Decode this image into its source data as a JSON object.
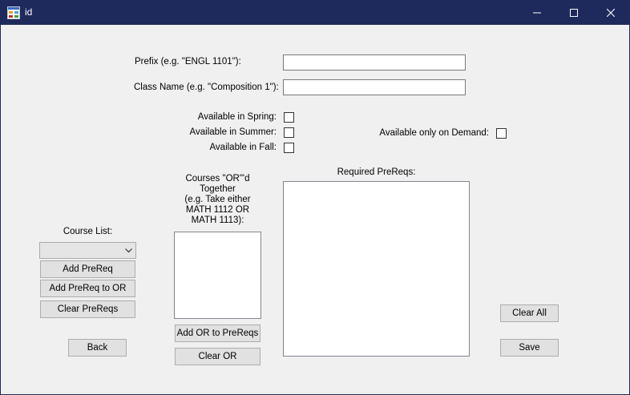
{
  "window": {
    "title": "id",
    "controls": {
      "minimize": "minimize-icon",
      "maximize": "maximize-icon",
      "close": "close-icon"
    }
  },
  "form": {
    "prefix_label": "Prefix (e.g. \"ENGL 1101\"):",
    "prefix_value": "",
    "class_name_label": "Class Name (e.g. \"Composition 1\"):",
    "class_name_value": "",
    "spring_label": "Available in Spring:",
    "summer_label": "Available in Summer:",
    "fall_label": "Available in Fall:",
    "on_demand_label": "Available only on Demand:",
    "spring_checked": false,
    "summer_checked": false,
    "fall_checked": false,
    "on_demand_checked": false
  },
  "course_list": {
    "label": "Course List:",
    "selected": "",
    "add_prereq": "Add PreReq",
    "add_prereq_to_or": "Add PreReq to OR",
    "clear_prereqs": "Clear PreReqs"
  },
  "or_group": {
    "label_line1": "Courses \"OR\"'d",
    "label_line2": "Together",
    "label_line3": "(e.g. Take either",
    "label_line4": "MATH 1112 OR",
    "label_line5": "MATH 1113):",
    "items": [],
    "add_or_to_prereqs": "Add OR to PreReqs",
    "clear_or": "Clear OR"
  },
  "required": {
    "label": "Required PreReqs:",
    "items": []
  },
  "actions": {
    "back": "Back",
    "clear_all": "Clear All",
    "save": "Save"
  }
}
